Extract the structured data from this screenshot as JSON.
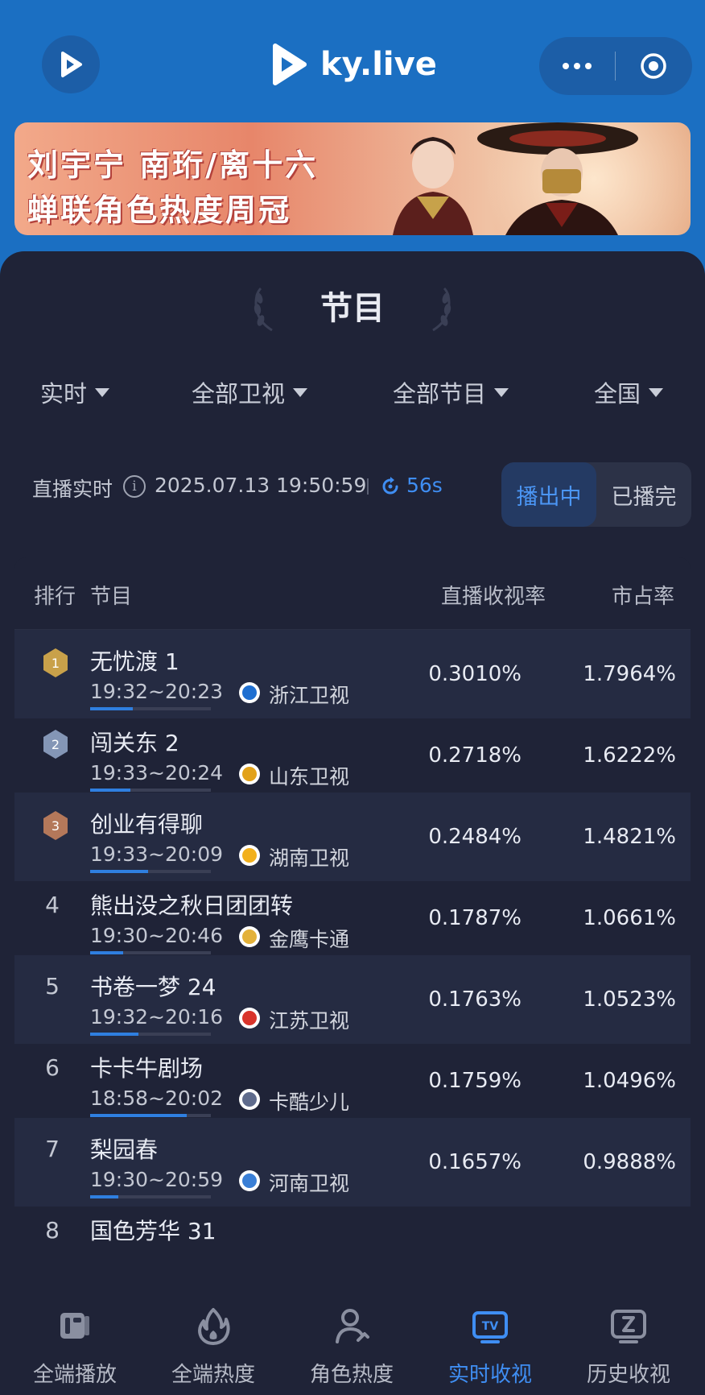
{
  "header": {
    "brand": "ky.live",
    "more_icon": "more-dots-icon",
    "target_icon": "target-icon"
  },
  "banner": {
    "line1": "刘宇宁 南珩/离十六",
    "line2": "蝉联角色热度周冠"
  },
  "section": {
    "title": "节目"
  },
  "filters": [
    {
      "label": "实时"
    },
    {
      "label": "全部卫视"
    },
    {
      "label": "全部节目"
    },
    {
      "label": "全国"
    }
  ],
  "status": {
    "label": "直播实时",
    "time": "2025.07.13 19:50:59",
    "countdown": "56s",
    "tab_live": "播出中",
    "tab_done": "已播完"
  },
  "table": {
    "headers": {
      "rank": "排行",
      "program": "节目",
      "rating": "直播收视率",
      "share": "市占率"
    },
    "rows": [
      {
        "rank": "1",
        "name": "无忧渡 1",
        "time": "19:32~20:23",
        "channel": "浙江卫视",
        "rating": "0.3010%",
        "share": "1.7964%",
        "progress": 0.35
      },
      {
        "rank": "2",
        "name": "闯关东 2",
        "time": "19:33~20:24",
        "channel": "山东卫视",
        "rating": "0.2718%",
        "share": "1.6222%",
        "progress": 0.33
      },
      {
        "rank": "3",
        "name": "创业有得聊",
        "time": "19:33~20:09",
        "channel": "湖南卫视",
        "rating": "0.2484%",
        "share": "1.4821%",
        "progress": 0.48
      },
      {
        "rank": "4",
        "name": "熊出没之秋日团团转",
        "time": "19:30~20:46",
        "channel": "金鹰卡通",
        "rating": "0.1787%",
        "share": "1.0661%",
        "progress": 0.27
      },
      {
        "rank": "5",
        "name": "书卷一梦 24",
        "time": "19:32~20:16",
        "channel": "江苏卫视",
        "rating": "0.1763%",
        "share": "1.0523%",
        "progress": 0.4
      },
      {
        "rank": "6",
        "name": "卡卡牛剧场",
        "time": "18:58~20:02",
        "channel": "卡酷少儿",
        "rating": "0.1759%",
        "share": "1.0496%",
        "progress": 0.8
      },
      {
        "rank": "7",
        "name": "梨园春",
        "time": "19:30~20:59",
        "channel": "河南卫视",
        "rating": "0.1657%",
        "share": "0.9888%",
        "progress": 0.23
      },
      {
        "rank": "8",
        "name": "国色芳华 31",
        "time": "",
        "channel": "",
        "rating": "",
        "share": "",
        "progress": 0
      }
    ]
  },
  "bottom_nav": [
    {
      "label": "全端播放",
      "icon": "playback-icon",
      "active": false
    },
    {
      "label": "全端热度",
      "icon": "flame-icon",
      "active": false
    },
    {
      "label": "角色热度",
      "icon": "person-icon",
      "active": false
    },
    {
      "label": "实时收视",
      "icon": "tv-icon",
      "active": true
    },
    {
      "label": "历史收视",
      "icon": "history-icon",
      "active": false
    }
  ],
  "colors": {
    "header_bg": "#1b6fc2",
    "panel_bg": "#1f2337",
    "accent": "#3f8ef3",
    "gold": "#c9a14a",
    "silver": "#8496b6",
    "bronze": "#b4785a"
  }
}
